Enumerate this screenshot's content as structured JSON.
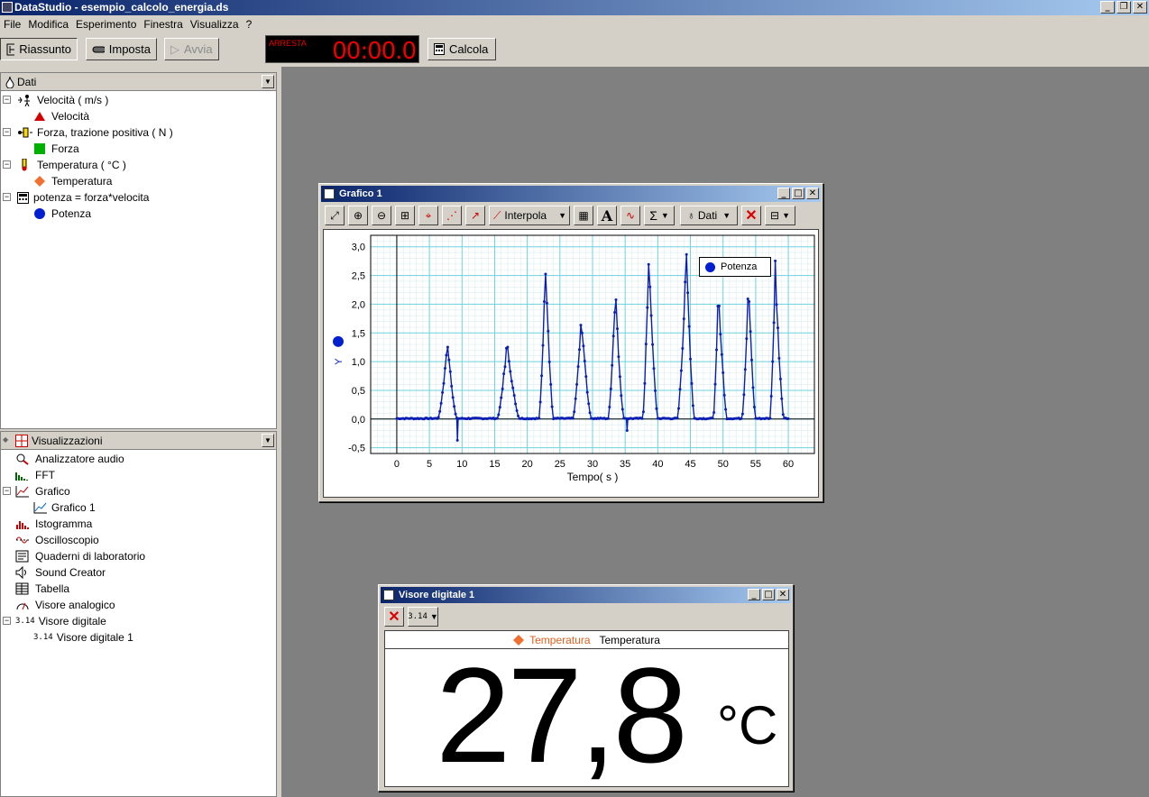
{
  "window": {
    "title": "DataStudio - esempio_calcolo_energia.ds"
  },
  "menu": [
    "File",
    "Modifica",
    "Esperimento",
    "Finestra",
    "Visualizza",
    "?"
  ],
  "toolbar": {
    "riassunto": "Riassunto",
    "imposta": "Imposta",
    "avvia": "Avvia",
    "timer_label": "ARRESTA",
    "timer": "00:00.0",
    "calcola": "Calcola"
  },
  "data_panel": {
    "header": "Dati",
    "items": [
      {
        "label": "Velocità ( m/s )",
        "child": "Velocità",
        "child_color": "#d40000",
        "child_shape": "triangle"
      },
      {
        "label": "Forza, trazione positiva ( N )",
        "child": "Forza",
        "child_color": "#00b000",
        "child_shape": "square"
      },
      {
        "label": "Temperatura ( °C )",
        "child": "Temperatura",
        "child_color": "#f07030",
        "child_shape": "diamond"
      },
      {
        "label": "potenza = forza*velocita",
        "child": "Potenza",
        "child_color": "#0020d0",
        "child_shape": "circle"
      }
    ]
  },
  "displays_panel": {
    "header": "Visualizzazioni",
    "items": [
      {
        "label": "Analizzatore audio",
        "level": 0
      },
      {
        "label": "FFT",
        "level": 0
      },
      {
        "label": "Grafico",
        "level": 0,
        "expanded": true
      },
      {
        "label": "Grafico 1",
        "level": 1
      },
      {
        "label": "Istogramma",
        "level": 0
      },
      {
        "label": "Oscilloscopio",
        "level": 0
      },
      {
        "label": "Quaderni di laboratorio",
        "level": 0
      },
      {
        "label": "Sound Creator",
        "level": 0
      },
      {
        "label": "Tabella",
        "level": 0
      },
      {
        "label": "Visore analogico",
        "level": 0
      },
      {
        "label": "Visore digitale",
        "level": 0,
        "expanded": true
      },
      {
        "label": "Visore digitale 1",
        "level": 1
      }
    ]
  },
  "graph_window": {
    "title": "Grafico 1",
    "interpola": "Interpola",
    "dati": "Dati",
    "sigma": "Σ"
  },
  "chart_data": {
    "type": "line",
    "xlabel": "Tempo( s )",
    "ylabel": "Y",
    "xlim": [
      -4,
      64
    ],
    "ylim": [
      -0.6,
      3.2
    ],
    "xticks": [
      "0",
      "5",
      "10",
      "15",
      "20",
      "25",
      "30",
      "35",
      "40",
      "45",
      "50",
      "55",
      "60"
    ],
    "yticks": [
      "3,0",
      "2,5",
      "2,0",
      "1,5",
      "1,0",
      "0,5",
      "0,0",
      "-0,5"
    ],
    "grid": true,
    "legend_position": "top-right",
    "color": "#0a1eb4",
    "series": [
      {
        "name": "Potenza",
        "peaks": [
          {
            "start": 6.3,
            "top": 7.8,
            "end": 9.2,
            "peak": 1.35
          },
          {
            "start": 15.4,
            "top": 16.9,
            "end": 18.8,
            "peak": 1.38
          },
          {
            "start": 21.8,
            "top": 22.8,
            "end": 24.0,
            "peak": 2.78
          },
          {
            "start": 27.0,
            "top": 28.3,
            "end": 29.8,
            "peak": 1.82
          },
          {
            "start": 32.4,
            "top": 33.5,
            "end": 34.8,
            "peak": 2.35
          },
          {
            "start": 37.7,
            "top": 38.6,
            "end": 40.0,
            "peak": 2.93
          },
          {
            "start": 43.0,
            "top": 44.4,
            "end": 45.6,
            "peak": 2.97
          },
          {
            "start": 48.5,
            "top": 49.3,
            "end": 50.6,
            "peak": 2.35
          },
          {
            "start": 52.9,
            "top": 53.9,
            "end": 55.0,
            "peak": 2.43
          },
          {
            "start": 57.2,
            "top": 58.0,
            "end": 59.3,
            "peak": 2.79
          }
        ],
        "outliers": [
          {
            "x": 9.3,
            "y": -0.37
          },
          {
            "x": 35.3,
            "y": -0.2
          }
        ]
      }
    ]
  },
  "digital_window": {
    "title": "Visore digitale 1",
    "legend_name": "Temperatura",
    "legend_label": "Temperatura",
    "value": "27,8",
    "unit": "°C"
  }
}
